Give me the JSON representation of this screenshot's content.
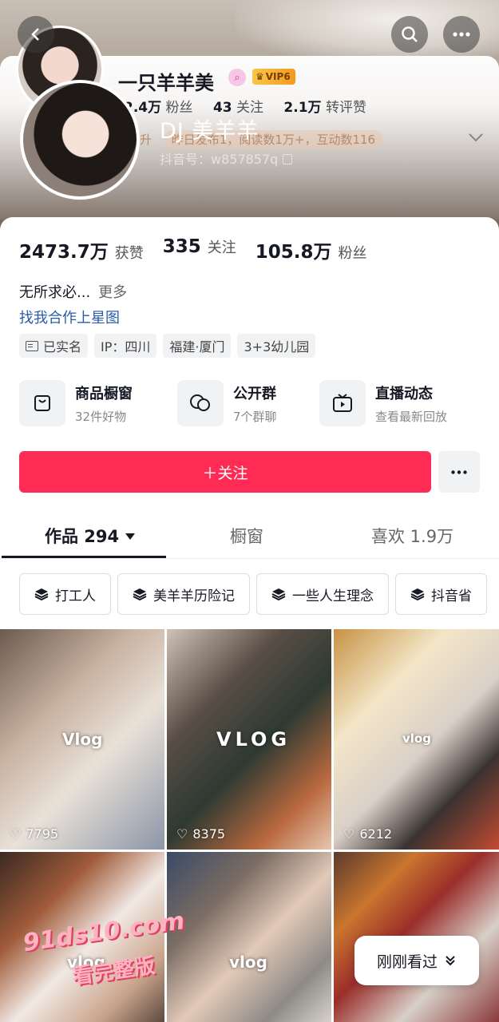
{
  "preview": {
    "name": "一只羊羊美",
    "vip": "VIP6",
    "stats": [
      {
        "num": "2.4万",
        "label": "粉丝"
      },
      {
        "num": "43",
        "label": "关注"
      },
      {
        "num": "2.1万",
        "label": "转评赞"
      }
    ],
    "ticker_left": "飙升",
    "ticker_text": "昨日发布1，阅读数1万+，互动数116",
    "overlay_name": "DJ 美羊羊",
    "douyin_id": "抖音号：w857857q"
  },
  "profile": {
    "counts": [
      {
        "num": "2473.7万",
        "label": "获赞"
      },
      {
        "num": "335",
        "label": "关注"
      },
      {
        "num": "105.8万",
        "label": "粉丝"
      }
    ],
    "bio": "无所求必...",
    "bio_more": "更多",
    "link": "找我合作上星图",
    "chips": [
      "已实名",
      "IP：四川",
      "福建·厦门",
      "3+3幼儿园"
    ],
    "entries": [
      {
        "title": "商品橱窗",
        "sub": "32件好物",
        "icon": "shop-bag-icon"
      },
      {
        "title": "公开群",
        "sub": "7个群聊",
        "icon": "chat-bubbles-icon"
      },
      {
        "title": "直播动态",
        "sub": "查看最新回放",
        "icon": "tv-play-icon"
      }
    ],
    "follow_label": "＋关注"
  },
  "tabs": [
    {
      "label": "作品 294",
      "active": true
    },
    {
      "label": "橱窗",
      "active": false
    },
    {
      "label": "喜欢 1.9万",
      "active": false
    }
  ],
  "collections": [
    "打工人",
    "美羊羊历险记",
    "一些人生理念",
    "抖音省"
  ],
  "videos": [
    {
      "tag": "Vlog",
      "likes": "7795"
    },
    {
      "tag": "VLOG",
      "likes": "8375"
    },
    {
      "tag": "vlog",
      "likes": "6212"
    },
    {
      "tag": "vlog",
      "likes": ""
    },
    {
      "tag": "vlog",
      "likes": ""
    }
  ],
  "watermark": {
    "line1": "91ds10.com",
    "line2": "看完整版"
  },
  "recent_label": "刚刚看过",
  "colors": {
    "accent": "#fe2c55",
    "link": "#2b5ba8"
  }
}
